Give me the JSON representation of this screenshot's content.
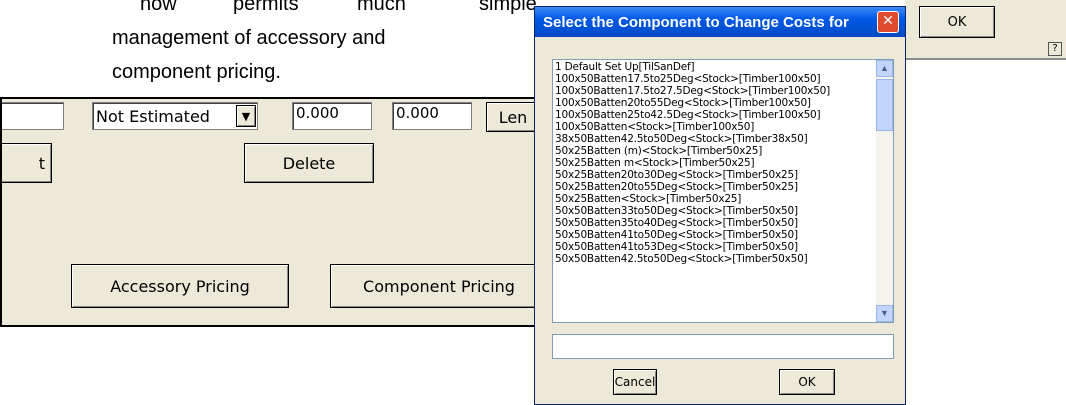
{
  "intro": {
    "line1_words": [
      "now",
      "permits",
      "much",
      "simple"
    ],
    "line2": "management of accessory and",
    "line3": "component pricing."
  },
  "background_dialog": {
    "ok_label": "OK",
    "checkbox_glyph": "?"
  },
  "main_dialog": {
    "estimate_select_value": "Not Estimated",
    "field1_value": "0.000",
    "field2_value": "0.000",
    "len_label": "Len",
    "field3_value": "0.",
    "left_button_partial": "t",
    "delete_label": "Delete",
    "accessory_pricing_label": "Accessory Pricing",
    "component_pricing_label": "Component Pricing"
  },
  "select_dialog": {
    "title": "Select the Component to Change Costs for",
    "close_glyph": "✕",
    "items": [
      "1 Default Set Up[TilSanDef]",
      "100x50Batten17.5to25Deg<Stock>[Timber100x50]",
      "100x50Batten17.5to27.5Deg<Stock>[Timber100x50]",
      "100x50Batten20to55Deg<Stock>[Timber100x50]",
      "100x50Batten25to42.5Deg<Stock>[Timber100x50]",
      "100x50Batten<Stock>[Timber100x50]",
      "38x50Batten42.5to50Deg<Stock>[Timber38x50]",
      "50x25Batten (m)<Stock>[Timber50x25]",
      "50x25Batten m<Stock>[Timber50x25]",
      "50x25Batten20to30Deg<Stock>[Timber50x25]",
      "50x25Batten20to55Deg<Stock>[Timber50x25]",
      "50x25Batten<Stock>[Timber50x25]",
      "50x50Batten33to50Deg<Stock>[Timber50x50]",
      "50x50Batten35to40Deg<Stock>[Timber50x50]",
      "50x50Batten41to50Deg<Stock>[Timber50x50]",
      "50x50Batten41to53Deg<Stock>[Timber50x50]",
      "50x50Batten42.5to50Deg<Stock>[Timber50x50]"
    ],
    "search_value": "",
    "cancel_label": "Cancel",
    "ok_label": "OK"
  },
  "icons": {
    "dropdown_arrow": "▼",
    "scroll_up": "▲",
    "scroll_down": "▼"
  }
}
